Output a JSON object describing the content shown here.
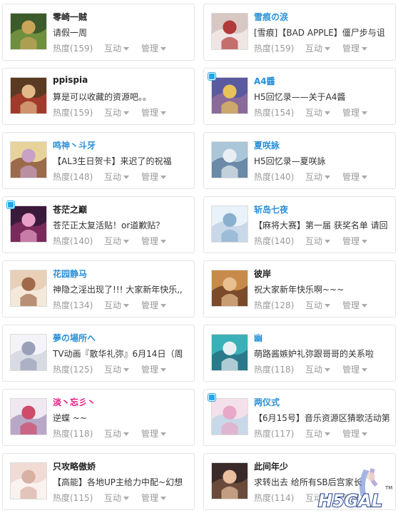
{
  "labels": {
    "heat_prefix": "热度",
    "interact": "互动",
    "manage": "管理"
  },
  "users": [
    {
      "name": "零崎一贼",
      "name_color": "dark",
      "status": "请假一周",
      "heat": 159,
      "badge": false,
      "thumb": [
        "#3d5a2a",
        "#c9a55a",
        "#6d8f3e"
      ]
    },
    {
      "name": "雪痕の涙",
      "name_color": "blue",
      "status": "[雪痕]【BAD APPLE】僵尸步与诅",
      "heat": 159,
      "badge": false,
      "thumb": [
        "#d7c8c4",
        "#b23a3a",
        "#efe6e4"
      ]
    },
    {
      "name": "ppispia",
      "name_color": "dark",
      "status": "算是可以收藏的资源吧。。",
      "heat": 159,
      "badge": false,
      "thumb": [
        "#5a3a22",
        "#e3b98a",
        "#a13a2a"
      ]
    },
    {
      "name": "A4醬",
      "name_color": "blue",
      "status": "H5回忆录——关于A4醬",
      "heat": 154,
      "badge": true,
      "thumb": [
        "#5a5aa0",
        "#e8c35a",
        "#8a6a9a"
      ]
    },
    {
      "name": "鸣神丶斗牙",
      "name_color": "blue",
      "status": "【AL3生日贺卡】来迟了的祝福",
      "heat": 148,
      "badge": false,
      "thumb": [
        "#e7d39a",
        "#c8a0c8",
        "#9a6a4a"
      ]
    },
    {
      "name": "夏咲詠",
      "name_color": "blue",
      "status": "H5回忆录—夏咲詠",
      "heat": 140,
      "badge": false,
      "thumb": [
        "#aac6d8",
        "#e8eef2",
        "#6a8aa8"
      ]
    },
    {
      "name": "苍茫之巅",
      "name_color": "dark",
      "status": "苍茫正太复活贴！or道歉贴？",
      "heat": 140,
      "badge": true,
      "thumb": [
        "#3a1a3a",
        "#e8a0c8",
        "#7a2a5a"
      ]
    },
    {
      "name": "斩岛七夜",
      "name_color": "blue",
      "status": "【麻将大赛】第一届 获奖名单 请回",
      "heat": 140,
      "badge": false,
      "thumb": [
        "#e8f2f8",
        "#8ab0d0",
        "#c8d8e8"
      ]
    },
    {
      "name": "花园静马",
      "name_color": "blue",
      "status": "神隐之淫出现了!!! 大家新年快乐,,",
      "heat": 134,
      "badge": false,
      "thumb": [
        "#e8d0b8",
        "#a06a4a",
        "#f4e8da"
      ]
    },
    {
      "name": "彼岸",
      "name_color": "dark",
      "status": "祝大家新年快乐啊~~~",
      "heat": 128,
      "badge": false,
      "thumb": [
        "#c88a4a",
        "#e8c090",
        "#7a4a2a"
      ]
    },
    {
      "name": "夢の場所へ",
      "name_color": "blue",
      "status": "TV动画『散华礼弥』6月14日（周",
      "heat": 125,
      "badge": false,
      "thumb": [
        "#f4f4f8",
        "#9aa0b8",
        "#d8dae4"
      ]
    },
    {
      "name": "幽",
      "name_color": "blue",
      "status": "萌路酱嫉妒礼弥跟哥哥的关系啦",
      "heat": 118,
      "badge": false,
      "thumb": [
        "#3ab0b8",
        "#e8f0f4",
        "#2a7a8a"
      ]
    },
    {
      "name": "淡丶忘彡丶",
      "name_color": "pink",
      "status": "逆蝶 ~~",
      "heat": 118,
      "badge": false,
      "thumb": [
        "#f0e8f0",
        "#d04a6a",
        "#b8a8c8"
      ]
    },
    {
      "name": "两仪式",
      "name_color": "blue",
      "status": "【6月15号】音乐资源区猜歌活动第",
      "heat": 117,
      "badge": true,
      "thumb": [
        "#f4e0ea",
        "#e8a8c8",
        "#c8d8e8"
      ]
    },
    {
      "name": "只攻略傲娇",
      "name_color": "dark",
      "status": "【高能】各地UP主给力中配~幻想",
      "heat": 115,
      "badge": false,
      "thumb": [
        "#f0dcd4",
        "#d8b0a4",
        "#faf2ee"
      ]
    },
    {
      "name": "此间年少",
      "name_color": "dark",
      "status": "求转出去 给所有SB后宫家长",
      "heat": 114,
      "badge": false,
      "thumb": [
        "#3a2a2a",
        "#e8c0a0",
        "#6a4a3a"
      ]
    }
  ],
  "watermark": {
    "text": "H5GAL",
    "tm": "TM"
  }
}
